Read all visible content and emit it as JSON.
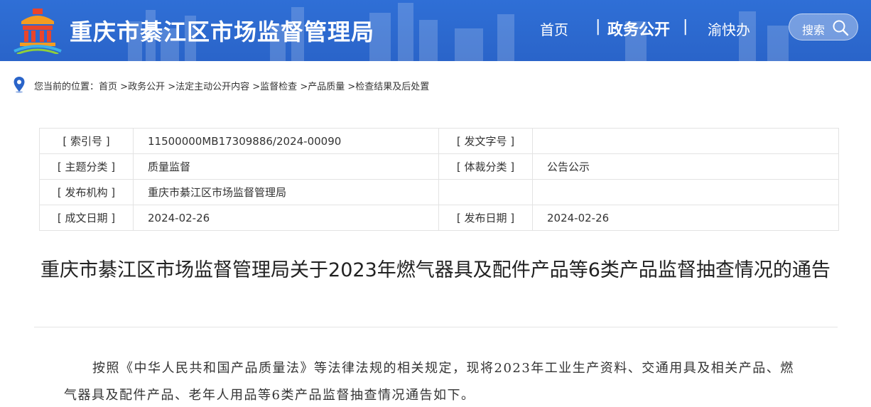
{
  "header": {
    "site_title": "重庆市綦江区市场监督管理局",
    "nav": {
      "home": "首页",
      "separator": "|",
      "gov_affairs": "政务公开",
      "yu_kuai_ban": "渝快办"
    },
    "search_label": "搜索"
  },
  "breadcrumb": {
    "prefix": "您当前的位置：",
    "items": [
      "首页",
      ">政务公开",
      ">法定主动公开内容",
      ">监督检查",
      ">产品质量",
      ">检查结果及后处置"
    ]
  },
  "info_table": {
    "rows": [
      {
        "k1": "[ 索引号 ]",
        "v1": "11500000MB17309886/2024-00090",
        "k2": "[ 发文字号 ]",
        "v2": ""
      },
      {
        "k1": "[ 主题分类 ]",
        "v1": "质量监督",
        "k2": "[ 体裁分类 ]",
        "v2": "公告公示"
      },
      {
        "k1": "[ 发布机构 ]",
        "v1": "重庆市綦江区市场监督管理局",
        "k2": "",
        "v2": ""
      },
      {
        "k1": "[ 成文日期 ]",
        "v1": "2024-02-26",
        "k2": "[ 发布日期 ]",
        "v2": "2024-02-26"
      }
    ]
  },
  "document": {
    "title": "重庆市綦江区市场监督管理局关于2023年燃气器具及配件产品等6类产品监督抽查情况的通告",
    "body": "按照《中华人民共和国产品质量法》等法律法规的相关规定，现将2023年工业生产资料、交通用具及相关产品、燃气器具及配件产品、老年人用品等6类产品监督抽查情况通告如下。"
  },
  "colors": {
    "header_blue": "#2f6fd6",
    "logo_red": "#e8452c",
    "logo_orange": "#f39c21",
    "table_border": "#e3e3e3"
  }
}
